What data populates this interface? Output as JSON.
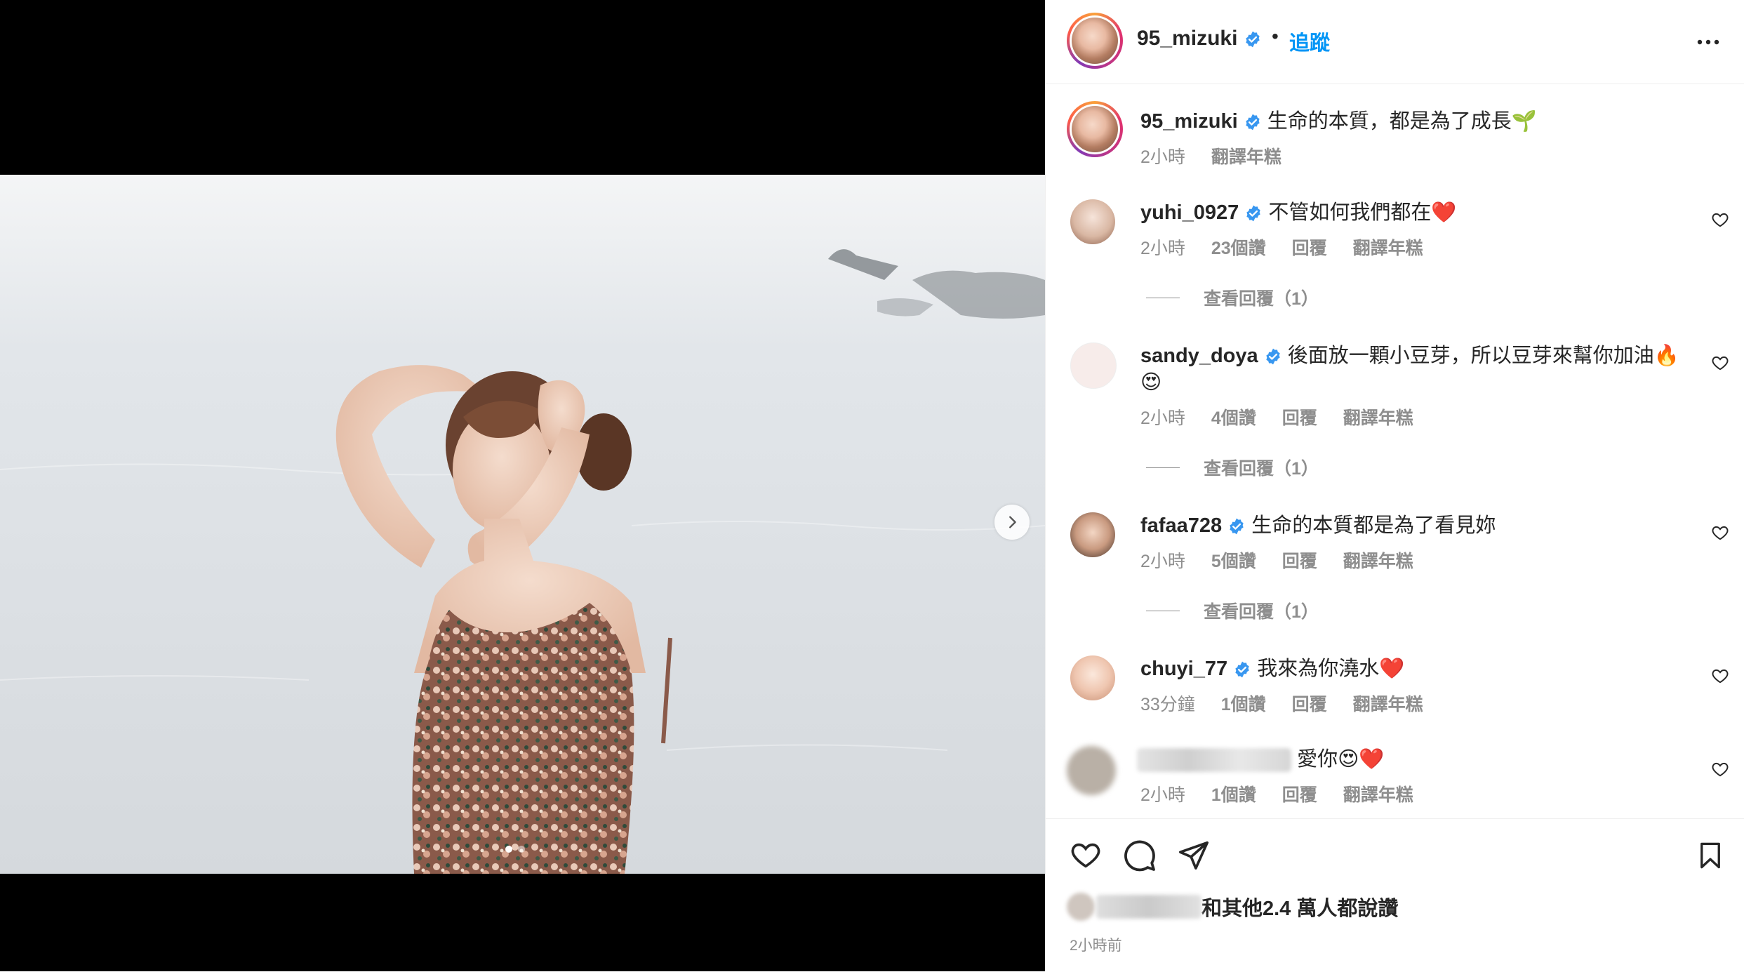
{
  "post": {
    "author": "95_mizuki",
    "follow_label": "追蹤",
    "separator": "•",
    "caption": "生命的本質，都是為了成長🌱",
    "caption_time": "2小時",
    "translate_label": "翻譯年糕",
    "carousel": {
      "total": 2,
      "current": 1
    }
  },
  "comments": [
    {
      "user": "yuhi_0927",
      "verified": true,
      "text": "不管如何我們都在❤️",
      "time": "2小時",
      "likes": "23個讚",
      "reply": "回覆",
      "translate": "翻譯年糕",
      "view_replies": "查看回覆（1）"
    },
    {
      "user": "sandy_doya",
      "verified": true,
      "text": "後面放一顆小豆芽，所以豆芽來幫你加油🔥😍",
      "time": "2小時",
      "likes": "4個讚",
      "reply": "回覆",
      "translate": "翻譯年糕",
      "view_replies": "查看回覆（1）"
    },
    {
      "user": "fafaa728",
      "verified": true,
      "text": "生命的本質都是為了看見妳",
      "time": "2小時",
      "likes": "5個讚",
      "reply": "回覆",
      "translate": "翻譯年糕",
      "view_replies": "查看回覆（1）"
    },
    {
      "user": "chuyi_77",
      "verified": true,
      "text": "我來為你澆水❤️",
      "time": "33分鐘",
      "likes": "1個讚",
      "reply": "回覆",
      "translate": "翻譯年糕"
    },
    {
      "user": "",
      "verified": false,
      "text": "愛你😍❤️",
      "time": "2小時",
      "likes": "1個讚",
      "reply": "回覆",
      "translate": "翻譯年糕"
    }
  ],
  "footer": {
    "likes_text": "和其他2.4 萬人都說讚",
    "timestamp": "2小時前"
  },
  "colors": {
    "accent": "#0095f6",
    "verified": "#3897f0",
    "muted": "#8e8e8e",
    "text": "#262626"
  },
  "icons": [
    "chevron-right-icon",
    "more-icon",
    "verified-icon",
    "heart-icon",
    "comment-icon",
    "share-icon",
    "bookmark-icon"
  ]
}
